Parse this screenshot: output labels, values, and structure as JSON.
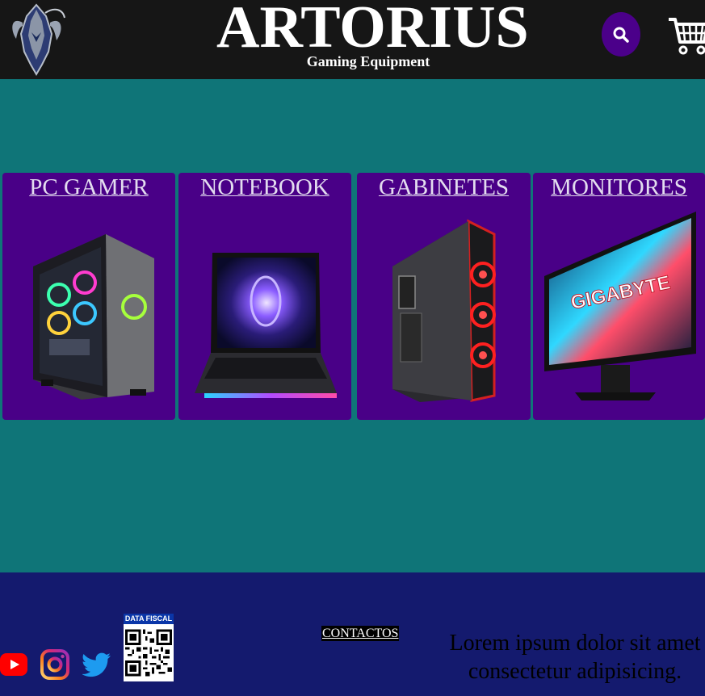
{
  "header": {
    "brand_title": "ARTORIUS",
    "brand_subtitle": "Gaming Equipment",
    "logo_icon": "knight-helmet-logo-icon",
    "search_icon": "search-icon",
    "cart_icon": "shopping-cart-icon"
  },
  "categories": [
    {
      "label": "PC GAMER",
      "image": "pc-gamer-tower-image"
    },
    {
      "label": "NOTEBOOK",
      "image": "gaming-laptop-image"
    },
    {
      "label": "GABINETES",
      "image": "pc-case-image"
    },
    {
      "label": "MONITORES",
      "image": "curved-monitor-image"
    }
  ],
  "monitor_brand": "GIGABYTE",
  "footer": {
    "social": [
      "youtube-icon",
      "instagram-icon",
      "twitter-icon"
    ],
    "qr_label": "DATA FISCAL",
    "contacts_label": "CONTACTOS",
    "lorem_text": "Lorem ipsum dolor sit amet consectetur adipisicing."
  },
  "colors": {
    "header_bg": "#161616",
    "page_bg": "#0f7578",
    "card_bg": "#490087",
    "footer_bg": "#141a6e",
    "accent_purple": "#4b008a"
  }
}
